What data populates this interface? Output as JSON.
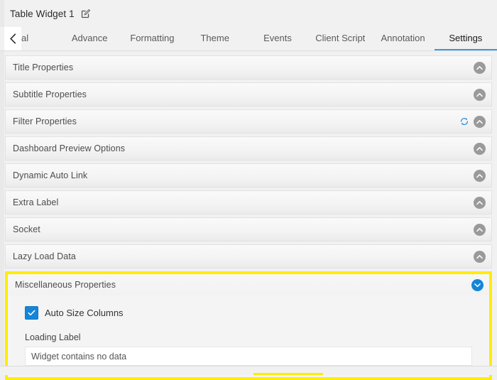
{
  "header": {
    "widget_title": "Table Widget 1",
    "edit_icon": "edit-pencil-icon"
  },
  "tabbar": {
    "scroll_left_icon": "chevron-left-icon",
    "tabs": [
      {
        "label": "al",
        "full_label": "General",
        "active": false,
        "truncated": true
      },
      {
        "label": "Advance",
        "active": false
      },
      {
        "label": "Formatting",
        "active": false
      },
      {
        "label": "Theme",
        "active": false
      },
      {
        "label": "Events",
        "active": false
      },
      {
        "label": "Client Script",
        "active": false
      },
      {
        "label": "Annotation",
        "active": false
      },
      {
        "label": "Settings",
        "active": true
      }
    ],
    "active_tab": "Settings",
    "active_underline_color": "#3b9ae1"
  },
  "panels": [
    {
      "title": "Title Properties",
      "expanded": false,
      "chevron_icon": "chevron-up-icon"
    },
    {
      "title": "Subtitle Properties",
      "expanded": false,
      "chevron_icon": "chevron-up-icon"
    },
    {
      "title": "Filter Properties",
      "expanded": false,
      "chevron_icon": "chevron-up-icon",
      "refresh_icon": "refresh-sync-icon"
    },
    {
      "title": "Dashboard Preview Options",
      "expanded": false,
      "chevron_icon": "chevron-up-icon"
    },
    {
      "title": "Dynamic Auto Link",
      "expanded": false,
      "chevron_icon": "chevron-up-icon"
    },
    {
      "title": "Extra Label",
      "expanded": false,
      "chevron_icon": "chevron-up-icon"
    },
    {
      "title": "Socket",
      "expanded": false,
      "chevron_icon": "chevron-up-icon"
    },
    {
      "title": "Lazy Load Data",
      "expanded": false,
      "chevron_icon": "chevron-up-icon"
    }
  ],
  "miscellaneous": {
    "title": "Miscellaneous Properties",
    "expanded": true,
    "chevron_icon": "chevron-down-icon",
    "highlight_color": "#ffed00",
    "auto_size_columns": {
      "label": "Auto Size Columns",
      "checked": true,
      "check_icon": "checkmark-icon"
    },
    "loading_label": {
      "label": "Loading Label",
      "value": "Widget contains no data",
      "placeholder": "Loading Label"
    }
  },
  "colors": {
    "accent_blue": "#1585d8",
    "highlight_yellow": "#ffed00",
    "chevron_gray": "#9a9a9a",
    "page_background": "#f1f1f1"
  }
}
